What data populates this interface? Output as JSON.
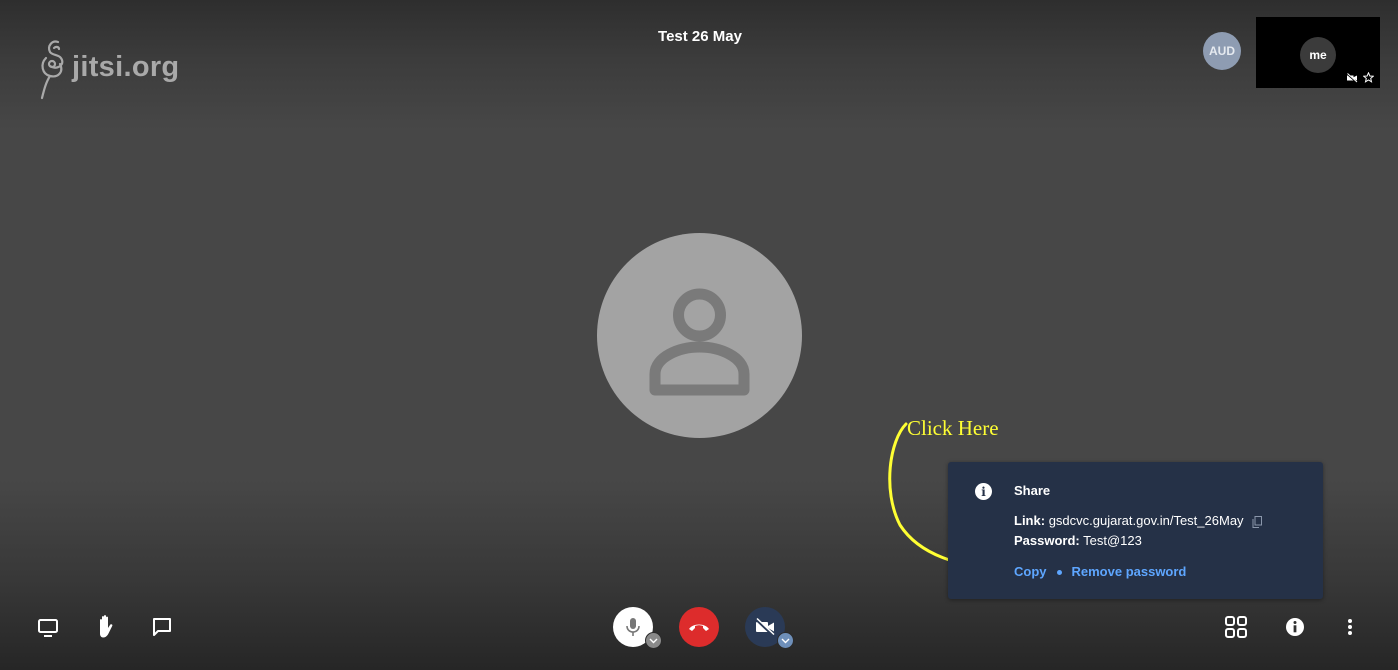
{
  "app": {
    "logo_text": "jitsi.org",
    "meeting_title": "Test 26 May"
  },
  "participants": {
    "remote_initials": "AUD",
    "local_label": "me"
  },
  "annotation": {
    "text": "Click Here",
    "color": "#ffff33"
  },
  "share_panel": {
    "title": "Share",
    "link_label": "Link:",
    "link_value": "gsdcvc.gujarat.gov.in/Test_26May",
    "password_label": "Password:",
    "password_value": "Test@123",
    "copy_action": "Copy",
    "remove_password_action": "Remove password",
    "info_glyph": "i"
  },
  "toolbar": {
    "left": [
      "screen-share-icon",
      "raise-hand-icon",
      "chat-icon"
    ],
    "center": [
      "microphone-icon",
      "hangup-icon",
      "camera-off-icon"
    ],
    "right": [
      "tile-view-icon",
      "info-icon",
      "more-options-icon"
    ]
  },
  "colors": {
    "panel_bg": "#253147",
    "link_blue": "#5ea6ff",
    "hangup_red": "#dd2c2c",
    "avatar_gray": "#a3a3a3"
  }
}
